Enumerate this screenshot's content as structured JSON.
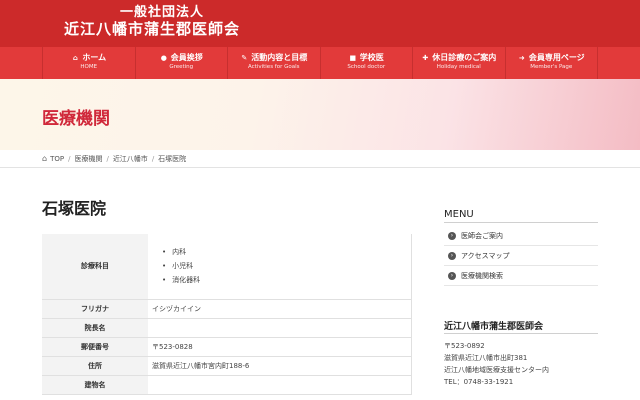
{
  "header": {
    "logo_line1": "一般社団法人",
    "logo_line2": "近江八幡市蒲生郡医師会"
  },
  "nav": [
    {
      "label": "ホーム",
      "sub": "HOME",
      "icon": "home-icon"
    },
    {
      "label": "会員挨拶",
      "sub": "Greeting",
      "icon": "person-icon"
    },
    {
      "label": "活動内容と目標",
      "sub": "Activities for Goals",
      "icon": "activities-icon"
    },
    {
      "label": "学校医",
      "sub": "School doctor",
      "icon": "school-icon"
    },
    {
      "label": "休日診療のご案内",
      "sub": "Holiday medical",
      "icon": "holiday-icon"
    },
    {
      "label": "会員専用ページ",
      "sub": "Member's Page",
      "icon": "login-icon"
    }
  ],
  "banner": {
    "title": "医療機関"
  },
  "breadcrumb": [
    "TOP",
    "医療機関",
    "近江八幡市",
    "石塚医院"
  ],
  "page": {
    "title": "石塚医院"
  },
  "info": {
    "departments_label": "診療科目",
    "departments": [
      "内科",
      "小児科",
      "消化器科"
    ],
    "rows": [
      {
        "label": "フリガナ",
        "value": "イシヅカイイン"
      },
      {
        "label": "院長名",
        "value": ""
      },
      {
        "label": "郵便番号",
        "value": "〒523-0828"
      },
      {
        "label": "住所",
        "value": "滋賀県近江八幡市宮内町188-6"
      },
      {
        "label": "建物名",
        "value": ""
      }
    ]
  },
  "sidebar": {
    "menu_title": "MENU",
    "menu_items": [
      "医師会ご案内",
      "アクセスマップ",
      "医療機関検索"
    ],
    "org_title": "近江八幡市蒲生郡医師会",
    "org_lines": [
      "〒523-0892",
      "滋賀県近江八幡市出町381",
      "近江八幡地域医療支援センター内",
      "TEL：0748-33-1921"
    ]
  },
  "colors": {
    "header": "#cc2a2a",
    "nav": "#e23a3a",
    "accent": "#d0283a"
  }
}
